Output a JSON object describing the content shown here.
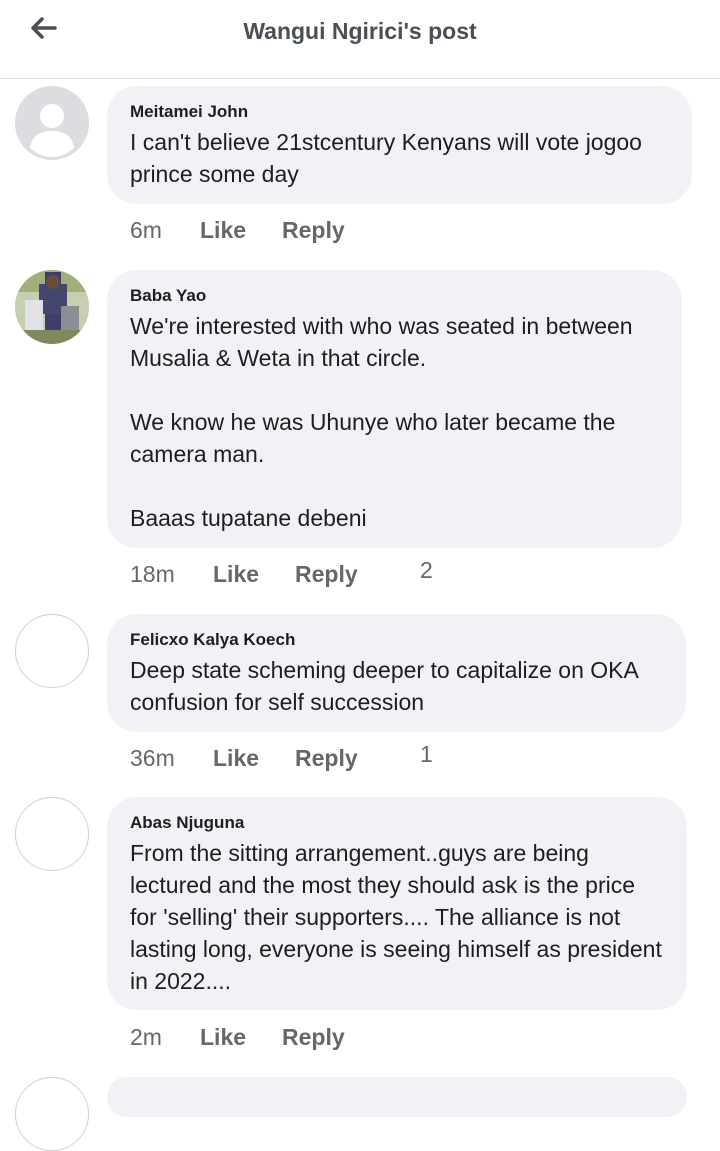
{
  "header": {
    "title": "Wangui Ngirici's post",
    "back_icon": "arrow-left-icon"
  },
  "comments": [
    {
      "author": "Meitamei John",
      "text": "I can't believe 21stcentury Kenyans will vote jogoo prince some day",
      "time": "6m",
      "like_label": "Like",
      "reply_label": "Reply",
      "avatar": "default-user-avatar"
    },
    {
      "author": "Baba Yao",
      "text": "We're interested with who was seated in between Musalia & Weta in that circle.\n\nWe know he was Uhunye who later became the camera man.\n\nBaaas tupatane debeni",
      "time": "18m",
      "like_label": "Like",
      "reply_label": "Reply",
      "reply_count": "2",
      "avatar": "photo-avatar"
    },
    {
      "author": "Felicxo Kalya Koech",
      "text": "Deep state scheming deeper to capitalize on OKA confusion for self succession",
      "time": "36m",
      "like_label": "Like",
      "reply_label": "Reply",
      "reply_count": "1",
      "avatar": "empty-avatar"
    },
    {
      "author": "Abas Njuguna",
      "text": "From the sitting arrangement..guys are being lectured and the most they should ask is the price for 'selling' their supporters.... The alliance is not lasting long, everyone is seeing himself as president in 2022....",
      "time": "2m",
      "like_label": "Like",
      "reply_label": "Reply",
      "avatar": "empty-avatar"
    }
  ],
  "colors": {
    "bubble_bg": "#f0f2f5",
    "secondary_text": "#65676b",
    "primary_text": "#1c1e21",
    "divider": "#dadde1"
  }
}
